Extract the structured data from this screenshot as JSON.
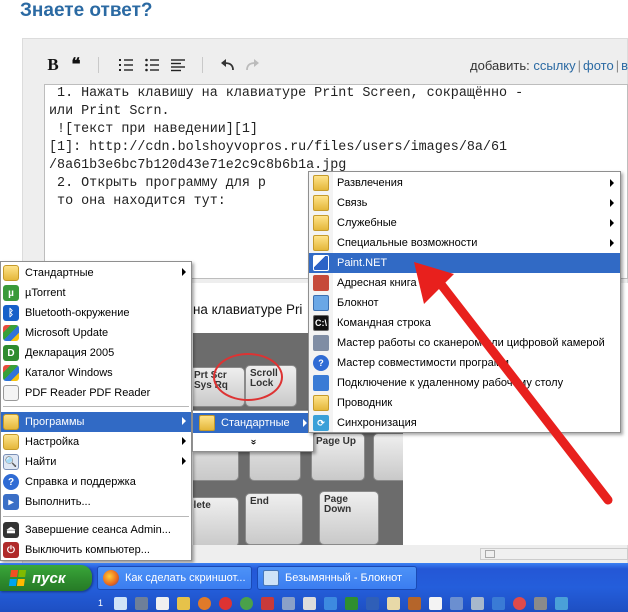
{
  "page": {
    "title": "Знаете ответ?"
  },
  "toolbar": {
    "bold": "B",
    "quote": "❝",
    "add_label": "добавить:",
    "links": [
      "ссылку",
      "фото",
      "в"
    ],
    "separator": "|"
  },
  "editor": {
    "lines": [
      " 1. Нажать клавишу на клавиатуре Print Screen, сокращённо -",
      "или Print Scrn.",
      " ![текст при наведении][1]",
      "[1]: http://cdn.bolshoyvopros.ru/files/users/images/8a/61",
      "/8a61b3e6bc7b120d43e71e2c9c8b6b1a.jpg",
      " 2. Открыть программу для р",
      " то она находится тут:"
    ]
  },
  "preview": {
    "caption": "на клавиатуре Pri",
    "keys": [
      "Prt Scr Sys Rq",
      "Scroll Lock",
      "Page Up",
      "Page Down",
      "End",
      "elete"
    ]
  },
  "start_menu": {
    "top_items": [
      {
        "label": "Стандартные",
        "icon": "folder-icon",
        "submenu": true
      },
      {
        "label": "µTorrent",
        "icon": "utorrent-icon",
        "submenu": false
      },
      {
        "label": "Bluetooth-окружение",
        "icon": "bluetooth-icon",
        "submenu": false
      },
      {
        "label": "Microsoft Update",
        "icon": "microsoft-update-icon",
        "submenu": false
      },
      {
        "label": "Декларация 2005",
        "icon": "declaration-icon",
        "submenu": false
      },
      {
        "label": "Каталог Windows",
        "icon": "windows-catalog-icon",
        "submenu": false
      },
      {
        "label": "PDF Reader PDF Reader",
        "icon": "pdf-icon",
        "submenu": false
      }
    ],
    "main_items": [
      {
        "label": "Программы",
        "icon": "programs-icon",
        "submenu": true,
        "highlighted": true
      },
      {
        "label": "Настройка",
        "icon": "settings-icon",
        "submenu": true,
        "highlighted": false
      },
      {
        "label": "Найти",
        "icon": "search-icon",
        "submenu": true,
        "highlighted": false
      },
      {
        "label": "Справка и поддержка",
        "icon": "help-icon",
        "submenu": false,
        "highlighted": false
      },
      {
        "label": "Выполнить...",
        "icon": "run-icon",
        "submenu": false,
        "highlighted": false
      }
    ],
    "bottom_items": [
      {
        "label": "Завершение сеанса Admin...",
        "icon": "logoff-icon"
      },
      {
        "label": "Выключить компьютер...",
        "icon": "shutdown-icon"
      }
    ]
  },
  "programs_submenu": {
    "item": "Стандартные",
    "expand": "»"
  },
  "standard_submenu": {
    "items": [
      {
        "label": "Развлечения",
        "icon": "folder-icon",
        "submenu": true,
        "highlighted": false
      },
      {
        "label": "Связь",
        "icon": "folder-icon",
        "submenu": true,
        "highlighted": false
      },
      {
        "label": "Служебные",
        "icon": "folder-icon",
        "submenu": true,
        "highlighted": false
      },
      {
        "label": "Специальные возможности",
        "icon": "folder-icon",
        "submenu": true,
        "highlighted": false
      },
      {
        "label": "Paint.NET",
        "icon": "paint-net-icon",
        "submenu": false,
        "highlighted": true
      },
      {
        "label": "Адресная книга",
        "icon": "address-book-icon",
        "submenu": false,
        "highlighted": false
      },
      {
        "label": "Блокнот",
        "icon": "notepad-icon",
        "submenu": false,
        "highlighted": false
      },
      {
        "label": "Командная строка",
        "icon": "cmd-icon",
        "submenu": false,
        "highlighted": false
      },
      {
        "label": "Мастер работы со сканером или цифровой камерой",
        "icon": "scanner-icon",
        "submenu": false,
        "highlighted": false
      },
      {
        "label": "Мастер совместимости программ",
        "icon": "compat-icon",
        "submenu": false,
        "highlighted": false
      },
      {
        "label": "Подключение к удаленному рабочему столу",
        "icon": "remote-desktop-icon",
        "submenu": false,
        "highlighted": false
      },
      {
        "label": "Проводник",
        "icon": "explorer-icon",
        "submenu": false,
        "highlighted": false
      },
      {
        "label": "Синхронизация",
        "icon": "sync-icon",
        "submenu": false,
        "highlighted": false
      }
    ]
  },
  "taskbar": {
    "start_label": "пуск",
    "tasks": [
      {
        "label": "Как сделать скриншот...",
        "icon": "firefox-icon"
      },
      {
        "label": "Безымянный - Блокнот",
        "icon": "notepad-icon"
      }
    ],
    "quicklaunch_number": "1"
  },
  "colors": {
    "title": "#2b6aa3",
    "highlight": "#316ac5",
    "arrow": "#e8201d",
    "taskbar": "#245edb",
    "start": "#2f8f2f"
  }
}
